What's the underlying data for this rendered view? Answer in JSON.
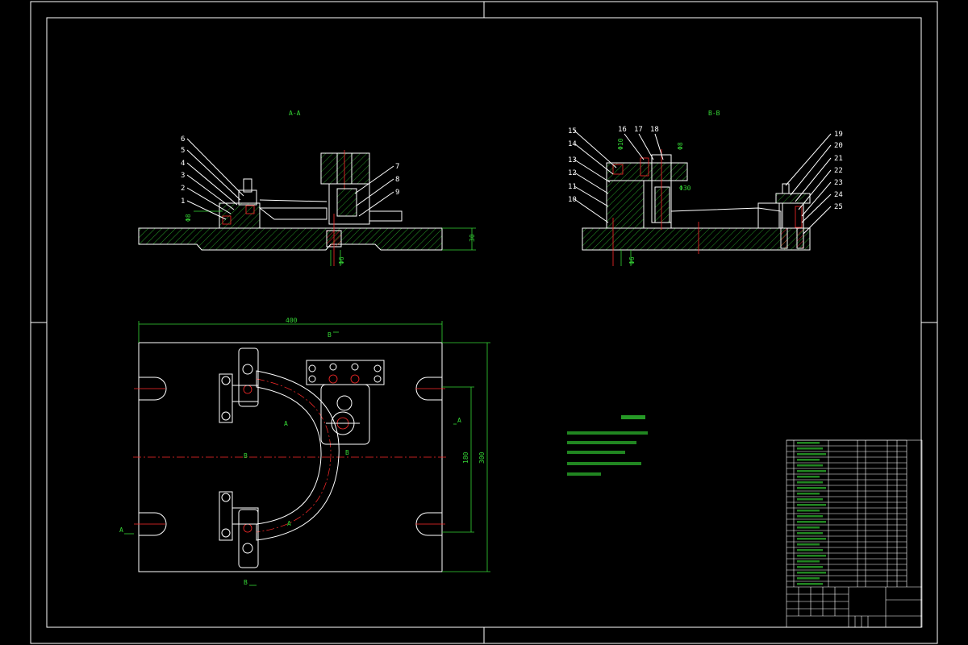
{
  "views": {
    "section_aa": "A-A",
    "section_bb": "B-B"
  },
  "part_numbers_left": [
    "6",
    "5",
    "4",
    "3",
    "2",
    "1"
  ],
  "part_numbers_mid": [
    "7",
    "8",
    "9"
  ],
  "part_numbers_bb_left": [
    "15",
    "14",
    "13",
    "12",
    "11",
    "10"
  ],
  "part_numbers_bb_top": [
    "16",
    "17",
    "18"
  ],
  "part_numbers_bb_right": [
    "19",
    "20",
    "21",
    "22",
    "23",
    "24",
    "25"
  ],
  "dimensions": {
    "width": "400",
    "height_total": "300",
    "height_inner": "180",
    "thickness": "30"
  },
  "section_markers": {
    "a_left": "A",
    "a_right": "A",
    "b_top": "B",
    "b_bottom": "B",
    "b_center": "B",
    "b_hole": "B",
    "a_arc": "A",
    "a_arc2": "A"
  },
  "colors": {
    "background": "#000000",
    "outline": "#ffffff",
    "annotation": "#35d635",
    "centerline": "#ff2a2a"
  }
}
